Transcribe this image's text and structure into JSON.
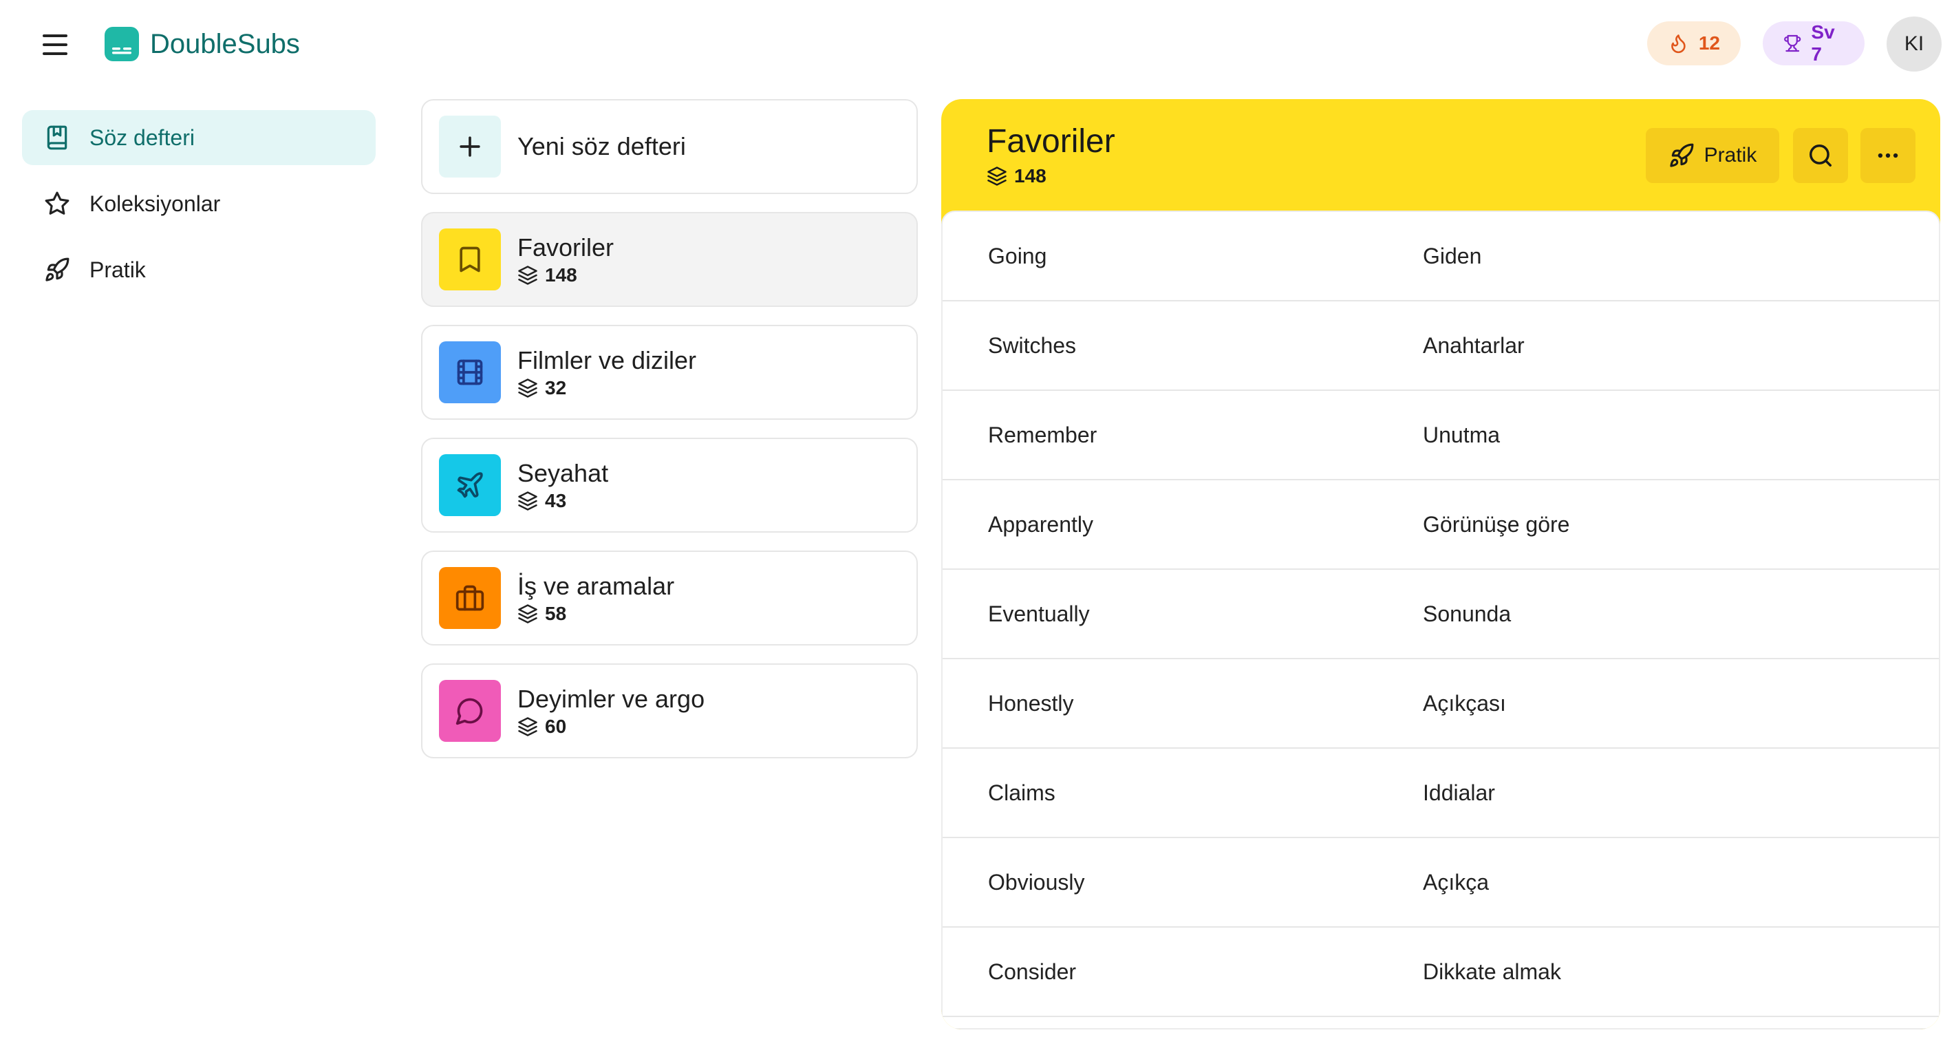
{
  "header": {
    "brand_name": "DoubleSubs",
    "streak_count": "12",
    "level_label": "Sv 7",
    "avatar_initials": "KI"
  },
  "sidebar": {
    "items": [
      {
        "label": "Söz defteri",
        "icon": "notebook-icon",
        "active": true
      },
      {
        "label": "Koleksiyonlar",
        "icon": "star-icon",
        "active": false
      },
      {
        "label": "Pratik",
        "icon": "rocket-icon",
        "active": false
      }
    ]
  },
  "notebooks": {
    "new_label": "Yeni söz defteri",
    "items": [
      {
        "title": "Favoriler",
        "count": "148",
        "icon": "bookmark-icon",
        "color": "#ffdf20",
        "icon_color": "#6b4f00"
      },
      {
        "title": "Filmler ve diziler",
        "count": "32",
        "icon": "film-icon",
        "color": "#4f9ef8",
        "icon_color": "#1e3a8a"
      },
      {
        "title": "Seyahat",
        "count": "43",
        "icon": "plane-icon",
        "color": "#15c8e8",
        "icon_color": "#0b4a66"
      },
      {
        "title": "İş ve aramalar",
        "count": "58",
        "icon": "briefcase-icon",
        "color": "#ff8a00",
        "icon_color": "#6b2d00"
      },
      {
        "title": "Deyimler ve argo",
        "count": "60",
        "icon": "chat-bubble-icon",
        "color": "#f05bb8",
        "icon_color": "#6b0f46"
      }
    ]
  },
  "detail": {
    "title": "Favoriler",
    "count": "148",
    "practice_label": "Pratik",
    "accent_color": "#ffdf20",
    "words": [
      {
        "word": "Going",
        "translation": "Giden"
      },
      {
        "word": "Switches",
        "translation": "Anahtarlar"
      },
      {
        "word": "Remember",
        "translation": "Unutma"
      },
      {
        "word": "Apparently",
        "translation": "Görünüşe göre"
      },
      {
        "word": "Eventually",
        "translation": "Sonunda"
      },
      {
        "word": "Honestly",
        "translation": "Açıkçası"
      },
      {
        "word": "Claims",
        "translation": "Iddialar"
      },
      {
        "word": "Obviously",
        "translation": "Açıkça"
      },
      {
        "word": "Consider",
        "translation": "Dikkate almak"
      }
    ]
  }
}
